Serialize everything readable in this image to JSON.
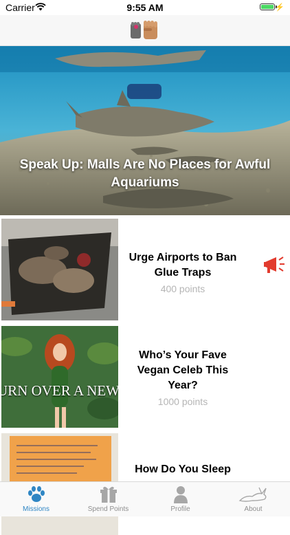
{
  "status_bar": {
    "carrier": "Carrier",
    "time": "9:55 AM",
    "battery_level": 1.0
  },
  "hero": {
    "title": "Speak Up: Malls Are No Places for Awful Aquariums"
  },
  "missions": [
    {
      "title": "Urge Airports to Ban Glue Traps",
      "points": "400 points",
      "badge_icon": "megaphone-icon"
    },
    {
      "title": "Who’s Your Fave Vegan Celeb This Year?",
      "points": "1000 points",
      "thumb_text": "URN OVER A NEW LEAF"
    },
    {
      "title": "How Do You Sleep",
      "points": ""
    }
  ],
  "tabs": [
    {
      "label": "Missions",
      "icon": "paw-icon",
      "active": true
    },
    {
      "label": "Spend Points",
      "icon": "gift-icon",
      "active": false
    },
    {
      "label": "Profile",
      "icon": "person-icon",
      "active": false
    },
    {
      "label": "About",
      "icon": "rabbit-icon",
      "active": false
    }
  ],
  "colors": {
    "accent": "#2f86c4",
    "megaphone": "#e23b2e",
    "points": "#b5b5b5"
  }
}
